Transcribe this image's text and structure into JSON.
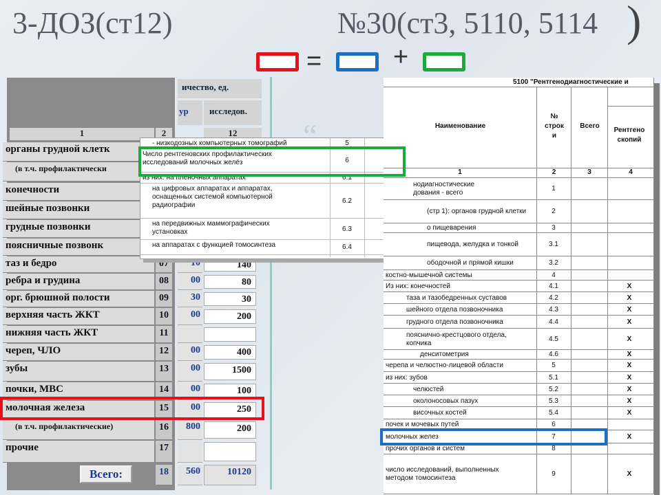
{
  "header": {
    "title_left": "3-ДОЗ(ст12)",
    "title_right": "№30(ст3, 5110, 5114",
    "close_paren": ")",
    "equals": "=",
    "plus": "+"
  },
  "colors": {
    "red": "#e5121c",
    "blue": "#1f6fc0",
    "green": "#1daa3c"
  },
  "left_form": {
    "head_qty": "ичество, ед.",
    "head_col_a": "ур",
    "head_col_b": "исследов.",
    "col_numbers": {
      "c1": "1",
      "c2": "2",
      "c12": "12"
    },
    "rows": [
      {
        "label": "органы грудной клетк",
        "num": "",
        "a": "",
        "b": ""
      },
      {
        "label": "(в т.ч. профилактически",
        "num": "",
        "a": "",
        "b": "",
        "sub": true
      },
      {
        "label": "конечности",
        "num": "",
        "a": "",
        "b": ""
      },
      {
        "label": "шейные позвонки",
        "num": "",
        "a": "",
        "b": ""
      },
      {
        "label": "грудные позвонки",
        "num": "",
        "a": "",
        "b": ""
      },
      {
        "label": "поясничные позвонк",
        "num": "",
        "a": "",
        "b": ""
      },
      {
        "label": "таз и бедро",
        "num": "07",
        "a": "10",
        "b": "140"
      },
      {
        "label": "ребра и грудина",
        "num": "08",
        "a": "00",
        "b": "80"
      },
      {
        "label": "орг. брюшной полости",
        "num": "09",
        "a": "30",
        "b": "30"
      },
      {
        "label": "верхняя часть ЖКТ",
        "num": "10",
        "a": "00",
        "b": "200"
      },
      {
        "label": "нижняя часть ЖКТ",
        "num": "11",
        "a": "",
        "b": ""
      },
      {
        "label": "череп, ЧЛО",
        "num": "12",
        "a": "00",
        "b": "400"
      },
      {
        "label": "зубы",
        "num": "13",
        "a": "00",
        "b": "1500"
      },
      {
        "label": "почки, МВС",
        "num": "14",
        "a": "00",
        "b": "100"
      },
      {
        "label": "молочная железа",
        "num": "15",
        "a": "00",
        "b": "250"
      },
      {
        "label": "(в т.ч. профилактические)",
        "num": "16",
        "a": "800",
        "b": "200",
        "sub": true
      },
      {
        "label": "прочие",
        "num": "17",
        "a": "",
        "b": ""
      }
    ],
    "total_button": "Всего:",
    "total_num": "18",
    "total_a": "560",
    "total_b": "10120"
  },
  "popup": {
    "rows": [
      {
        "label": "- низкодозных компьютерных томографий",
        "num": "5"
      },
      {
        "label": "Число рентгеновских профилактических\nисследований молочных желёз",
        "num": "6"
      },
      {
        "label": "из них: на пленочных аппаратах",
        "num": "6.1"
      },
      {
        "label": "на цифровых аппаратах и аппаратах,\nоснащенных системой компьютерной\nрадиографии",
        "num": "6.2"
      },
      {
        "label": "на передвижных маммографических\nустановках",
        "num": "6.3"
      },
      {
        "label": "на аппаратах с функцией томосинтеза",
        "num": "6.4"
      }
    ]
  },
  "right_form": {
    "title": "5100 \"Рентгенодиагностические и",
    "col_name": "Наименование",
    "col_row": "№\nстрок\nи",
    "col_total": "Всего",
    "col_xray": "Рентгено\nскопий",
    "col_nums": [
      "1",
      "2",
      "3",
      "4"
    ],
    "rows": [
      {
        "label": "нодиагностические\nдования - всего",
        "num": "1",
        "x": ""
      },
      {
        "label": "(стр 1): органов грудной клетки",
        "num": "2",
        "x": ""
      },
      {
        "label": "о пищеварения",
        "num": "3",
        "x": ""
      },
      {
        "label": "пищевода, желудка и тонкой",
        "num": "3.1",
        "x": ""
      },
      {
        "label": "ободочной и прямой кишки",
        "num": "3.2",
        "x": ""
      },
      {
        "label": "костно-мышечной системы",
        "num": "4",
        "x": ""
      },
      {
        "label": "Из них: конечностей",
        "num": "4.1",
        "x": "Х"
      },
      {
        "label": "таза и тазобедренных суставов",
        "num": "4.2",
        "x": "Х"
      },
      {
        "label": "шейного отдела позвоночника",
        "num": "4.3",
        "x": "Х"
      },
      {
        "label": "грудного отдела позвоночника",
        "num": "4.4",
        "x": "Х"
      },
      {
        "label": "пояснично-крестцового отдела,\nкопчика",
        "num": "4.5",
        "x": "Х"
      },
      {
        "label": "денситометрия",
        "num": "4.6",
        "x": "Х"
      },
      {
        "label": "черепа и челюстно-лицевой области",
        "num": "5",
        "x": "Х"
      },
      {
        "label": "из них: зубов",
        "num": "5.1",
        "x": "Х"
      },
      {
        "label": "челюстей",
        "num": "5.2",
        "x": "Х"
      },
      {
        "label": "околоносовых пазух",
        "num": "5.3",
        "x": "Х"
      },
      {
        "label": "височных костей",
        "num": "5.4",
        "x": "Х"
      },
      {
        "label": "почек и мочевых путей",
        "num": "6",
        "x": ""
      },
      {
        "label": "молочных желез",
        "num": "7",
        "x": "Х"
      },
      {
        "label": "прочих органов и систем",
        "num": "8",
        "x": ""
      },
      {
        "label": "число исследований, выполненных\nметодом томосинтеза",
        "num": "9",
        "x": "Х"
      }
    ]
  }
}
